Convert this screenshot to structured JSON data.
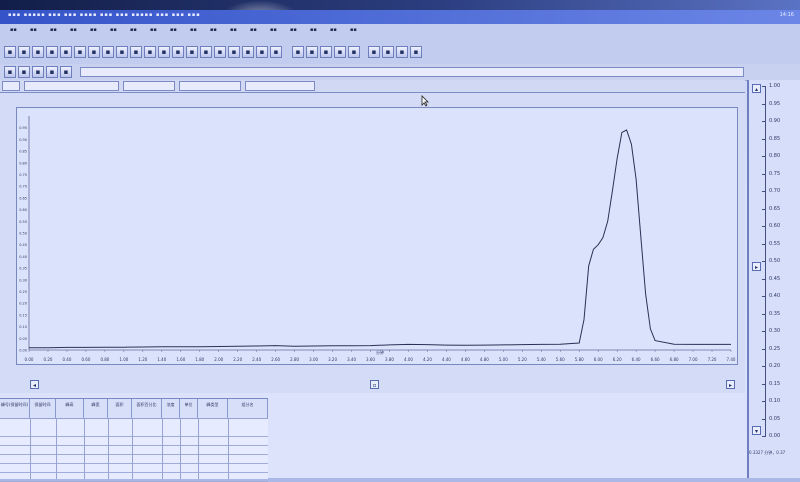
{
  "window": {
    "time_text": "14:16"
  },
  "chart_data": {
    "type": "line",
    "x": [
      0.0,
      0.2,
      0.4,
      0.6,
      0.8,
      1.0,
      1.2,
      1.4,
      1.6,
      1.8,
      2.0,
      2.2,
      2.4,
      2.6,
      2.8,
      3.0,
      3.2,
      3.4,
      3.6,
      3.8,
      4.0,
      4.2,
      4.4,
      4.6,
      4.8,
      5.0,
      5.2,
      5.4,
      5.6,
      5.8,
      5.85,
      5.9,
      5.95,
      6.0,
      6.05,
      6.1,
      6.15,
      6.2,
      6.25,
      6.3,
      6.35,
      6.4,
      6.45,
      6.5,
      6.55,
      6.6,
      6.8,
      7.0,
      7.2,
      7.4
    ],
    "y": [
      0.01,
      0.01,
      0.011,
      0.011,
      0.012,
      0.012,
      0.013,
      0.014,
      0.014,
      0.014,
      0.015,
      0.016,
      0.017,
      0.019,
      0.016,
      0.017,
      0.018,
      0.018,
      0.019,
      0.022,
      0.024,
      0.023,
      0.021,
      0.02,
      0.021,
      0.022,
      0.023,
      0.024,
      0.025,
      0.03,
      0.13,
      0.36,
      0.43,
      0.45,
      0.48,
      0.55,
      0.68,
      0.82,
      0.93,
      0.94,
      0.88,
      0.73,
      0.48,
      0.24,
      0.09,
      0.04,
      0.025,
      0.024,
      0.024,
      0.024
    ],
    "xlim": [
      0.0,
      7.4
    ],
    "ylim": [
      0.0,
      1.0
    ],
    "x_tick_labels": [
      "0.00",
      "0.20",
      "0.40",
      "0.60",
      "0.80",
      "1.00",
      "1.20",
      "1.40",
      "1.60",
      "1.80",
      "2.00",
      "2.20",
      "2.40",
      "2.60",
      "2.80",
      "3.00",
      "3.20",
      "3.40",
      "3.60",
      "3.80",
      "4.00",
      "4.20",
      "4.40",
      "4.60",
      "4.80",
      "5.00",
      "5.20",
      "5.40",
      "5.60",
      "5.80",
      "6.00",
      "6.20",
      "6.40",
      "6.60",
      "6.80",
      "7.00",
      "7.20",
      "7.40"
    ],
    "x_axis_label": "分钟",
    "y_tick_labels": [
      "0.95",
      "0.90",
      "0.85",
      "0.80",
      "0.75",
      "0.70",
      "0.65",
      "0.60",
      "0.55",
      "0.50",
      "0.45",
      "0.40",
      "0.35",
      "0.30",
      "0.25",
      "0.20",
      "0.15",
      "0.10",
      "0.05",
      "0.00"
    ],
    "grid": false,
    "legend": "none"
  },
  "right_scale": {
    "labels": [
      "1.00",
      "0.95",
      "0.90",
      "0.85",
      "0.80",
      "0.75",
      "0.70",
      "0.65",
      "0.60",
      "0.55",
      "0.50",
      "0.45",
      "0.40",
      "0.35",
      "0.30",
      "0.25",
      "0.20",
      "0.15",
      "0.10",
      "0.05",
      "0.00"
    ],
    "readout": "0.3327 分钟，0.37"
  },
  "grid_table": {
    "headers": [
      "峰号(保留时间)",
      "保留时间",
      "峰高",
      "峰宽",
      "面积",
      "面积百分比",
      "浓度",
      "单位",
      "峰类型",
      "组分名"
    ]
  }
}
